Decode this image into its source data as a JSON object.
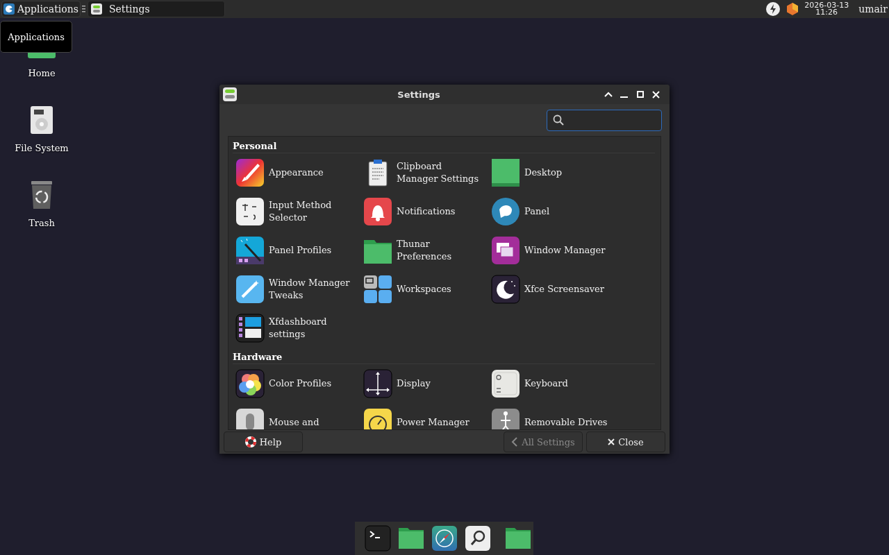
{
  "top_panel": {
    "menu_button": "Applications",
    "tasks": [
      {
        "label": "Settings",
        "selected": true
      }
    ],
    "clock": {
      "date": "2026-03-13",
      "time": "11:26"
    },
    "user": "umair"
  },
  "tooltip": "Applications",
  "desktop_icons": [
    {
      "label": "Home"
    },
    {
      "label": "File System"
    },
    {
      "label": "Trash"
    }
  ],
  "window": {
    "title": "Settings",
    "sections": [
      {
        "title": "Personal",
        "items": [
          {
            "label": "Appearance"
          },
          {
            "label": "Clipboard Manager Settings"
          },
          {
            "label": "Desktop"
          },
          {
            "label": "Input Method Selector"
          },
          {
            "label": "Notifications"
          },
          {
            "label": "Panel"
          },
          {
            "label": "Panel Profiles"
          },
          {
            "label": "Thunar Preferences"
          },
          {
            "label": "Window Manager"
          },
          {
            "label": "Window Manager Tweaks"
          },
          {
            "label": "Workspaces"
          },
          {
            "label": "Xfce Screensaver"
          },
          {
            "label": "Xfdashboard settings"
          }
        ]
      },
      {
        "title": "Hardware",
        "items": [
          {
            "label": "Color Profiles"
          },
          {
            "label": "Display"
          },
          {
            "label": "Keyboard"
          },
          {
            "label": "Mouse and"
          },
          {
            "label": "Power Manager"
          },
          {
            "label": "Removable Drives"
          }
        ]
      }
    ],
    "buttons": [
      {
        "label": "Help",
        "disabled": false
      },
      {
        "label": "All Settings",
        "disabled": true
      },
      {
        "label": "Close",
        "disabled": false
      }
    ]
  },
  "dock": {
    "items": [
      {
        "kind": "launcher"
      },
      {
        "kind": "launcher"
      },
      {
        "kind": "launcher"
      },
      {
        "kind": "launcher"
      },
      {
        "kind": "launcher"
      }
    ]
  }
}
